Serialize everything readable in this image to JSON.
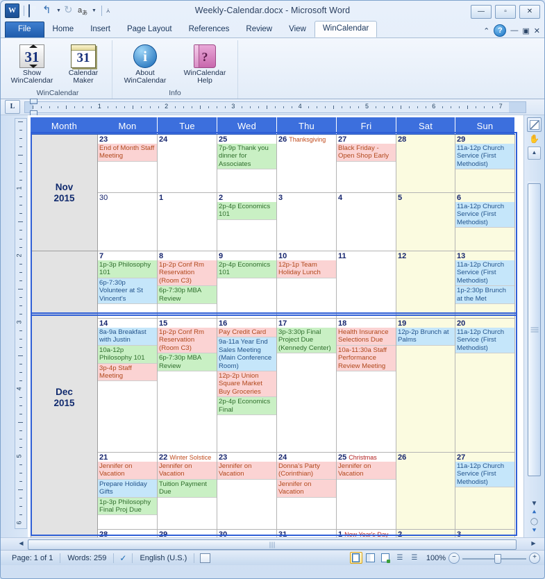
{
  "window": {
    "title": "Weekly-Calendar.docx  -  Microsoft Word",
    "app_icon": "W",
    "quick_access": [
      "save-icon",
      "undo-icon",
      "redo-icon",
      "language-icon",
      "customize-qat-icon"
    ],
    "minimize": "—",
    "restore": "▫",
    "close": "✕"
  },
  "tabs": [
    {
      "label": "File",
      "type": "file"
    },
    {
      "label": "Home",
      "type": "normal"
    },
    {
      "label": "Insert",
      "type": "normal"
    },
    {
      "label": "Page Layout",
      "type": "normal"
    },
    {
      "label": "References",
      "type": "normal"
    },
    {
      "label": "Review",
      "type": "normal"
    },
    {
      "label": "View",
      "type": "normal"
    },
    {
      "label": "WinCalendar",
      "type": "active"
    }
  ],
  "tab_right": {
    "help": "?",
    "minimize_ribbon": "—",
    "restore_win": "▣",
    "close_win": "✕"
  },
  "ribbon": {
    "groups": [
      {
        "label": "WinCalendar",
        "buttons": [
          {
            "label1": "Show",
            "label2": "WinCalendar",
            "icon": "calendar-31-spinner-icon",
            "glyph": "31"
          },
          {
            "label1": "Calendar",
            "label2": "Maker",
            "icon": "calendar-31-icon",
            "glyph": "31"
          }
        ]
      },
      {
        "label": "Info",
        "buttons": [
          {
            "label1": "About",
            "label2": "WinCalendar",
            "icon": "info-circle-icon",
            "glyph": "i"
          },
          {
            "label1": "WinCalendar",
            "label2": "Help",
            "icon": "help-book-icon",
            "glyph": "?"
          }
        ]
      }
    ]
  },
  "ruler": {
    "tab_stop": "L",
    "h_numbers": [
      "1",
      "2",
      "3",
      "4",
      "5",
      "6",
      "7"
    ],
    "v_numbers": [
      "1",
      "2",
      "3",
      "4",
      "5",
      "6"
    ]
  },
  "calendar": {
    "headers": [
      "Month",
      "Mon",
      "Tue",
      "Wed",
      "Thu",
      "Fri",
      "Sat",
      "Sun"
    ],
    "months": [
      {
        "name": "Nov",
        "year": "2015"
      },
      {
        "name": "Dec",
        "year": "2015"
      }
    ],
    "weeks": [
      {
        "month_label": "Nov\n2015",
        "days": [
          {
            "num": "23",
            "holiday": "",
            "weekend": false,
            "events": [
              {
                "text": "End of Month Staff Meeting",
                "color": "pink"
              }
            ]
          },
          {
            "num": "24",
            "holiday": "",
            "weekend": false,
            "events": []
          },
          {
            "num": "25",
            "holiday": "",
            "weekend": false,
            "events": [
              {
                "text": "7p-9p Thank you dinner for Associates",
                "color": "green"
              }
            ]
          },
          {
            "num": "26",
            "holiday": "Thanksgiving",
            "weekend": false,
            "events": []
          },
          {
            "num": "27",
            "holiday": "",
            "weekend": false,
            "events": [
              {
                "text": "Black Friday - Open Shop Early",
                "color": "pink"
              }
            ]
          },
          {
            "num": "28",
            "holiday": "",
            "weekend": true,
            "events": []
          },
          {
            "num": "29",
            "holiday": "",
            "weekend": true,
            "events": [
              {
                "text": "11a-12p Church Service (First Methodist)",
                "color": "blue"
              }
            ]
          }
        ]
      },
      {
        "month_label": "",
        "selected": true,
        "days": [
          {
            "num": "30",
            "dim": true,
            "holiday": "",
            "weekend": false,
            "events": []
          },
          {
            "num": "1",
            "holiday": "",
            "weekend": false,
            "events": []
          },
          {
            "num": "2",
            "holiday": "",
            "weekend": false,
            "events": [
              {
                "text": "2p-4p Economics 101",
                "color": "green"
              }
            ]
          },
          {
            "num": "3",
            "holiday": "",
            "weekend": false,
            "events": []
          },
          {
            "num": "4",
            "holiday": "",
            "weekend": false,
            "events": []
          },
          {
            "num": "5",
            "holiday": "",
            "weekend": true,
            "events": []
          },
          {
            "num": "6",
            "holiday": "",
            "weekend": true,
            "events": [
              {
                "text": "11a-12p Church Service (First Methodist)",
                "color": "blue"
              }
            ]
          }
        ]
      },
      {
        "month_label": "Dec\n2015",
        "days": [
          {
            "num": "7",
            "holiday": "",
            "weekend": false,
            "events": [
              {
                "text": "1p-3p Philosophy 101",
                "color": "green"
              },
              {
                "text": "6p-7:30p Volunteer at St Vincent's",
                "color": "blue"
              }
            ]
          },
          {
            "num": "8",
            "holiday": "",
            "weekend": false,
            "events": [
              {
                "text": "1p-2p Conf Rm Reservation (Room C3)",
                "color": "pink"
              },
              {
                "text": "6p-7:30p MBA Review",
                "color": "green"
              }
            ]
          },
          {
            "num": "9",
            "holiday": "",
            "weekend": false,
            "events": [
              {
                "text": "2p-4p Economics 101",
                "color": "green"
              }
            ]
          },
          {
            "num": "10",
            "holiday": "",
            "weekend": false,
            "events": [
              {
                "text": "12p-1p Team Holiday Lunch",
                "color": "pink"
              }
            ]
          },
          {
            "num": "11",
            "holiday": "",
            "weekend": false,
            "events": []
          },
          {
            "num": "12",
            "holiday": "",
            "weekend": true,
            "events": []
          },
          {
            "num": "13",
            "holiday": "",
            "weekend": true,
            "events": [
              {
                "text": "11a-12p Church Service (First Methodist)",
                "color": "blue"
              },
              {
                "text": "1p-2:30p Brunch at the Met",
                "color": "blue"
              }
            ]
          }
        ]
      },
      {
        "month_label": "",
        "days": [
          {
            "num": "14",
            "holiday": "",
            "weekend": false,
            "events": [
              {
                "text": "8a-9a Breakfast with Justin",
                "color": "blue"
              },
              {
                "text": "10a-12p Philosophy 101",
                "color": "green"
              },
              {
                "text": "3p-4p Staff Meeting",
                "color": "pink"
              }
            ]
          },
          {
            "num": "15",
            "holiday": "",
            "weekend": false,
            "events": [
              {
                "text": "1p-2p Conf Rm Reservation (Room C3)",
                "color": "pink"
              },
              {
                "text": "6p-7:30p MBA Review",
                "color": "green"
              }
            ]
          },
          {
            "num": "16",
            "holiday": "",
            "weekend": false,
            "events": [
              {
                "text": "Pay Credit Card",
                "color": "pink"
              },
              {
                "text": "9a-11a Year End Sales Meeting (Main Conference Room)",
                "color": "blue"
              },
              {
                "text": "12p-2p Union Square Market Buy Groceries",
                "color": "pink"
              },
              {
                "text": "2p-4p Economics Final",
                "color": "green"
              }
            ]
          },
          {
            "num": "17",
            "holiday": "",
            "weekend": false,
            "events": [
              {
                "text": "3p-3:30p Final Project Due (Kennedy Center)",
                "color": "green"
              }
            ]
          },
          {
            "num": "18",
            "holiday": "",
            "weekend": false,
            "events": [
              {
                "text": "Health Insurance Selections Due",
                "color": "pink"
              },
              {
                "text": "10a-11:30a Staff Performance Review Meeting",
                "color": "pink"
              }
            ]
          },
          {
            "num": "19",
            "holiday": "",
            "weekend": true,
            "events": [
              {
                "text": "12p-2p Brunch at Palms",
                "color": "blue"
              }
            ]
          },
          {
            "num": "20",
            "holiday": "",
            "weekend": true,
            "events": [
              {
                "text": "11a-12p Church Service (First Methodist)",
                "color": "blue"
              }
            ]
          }
        ]
      },
      {
        "month_label": "",
        "days": [
          {
            "num": "21",
            "holiday": "",
            "weekend": false,
            "events": [
              {
                "text": "Jennifer on Vacation",
                "color": "pink"
              },
              {
                "text": "Prepare Holiday Gifts",
                "color": "blue"
              },
              {
                "text": "1p-3p Philosophy Final Proj Due",
                "color": "green"
              }
            ]
          },
          {
            "num": "22",
            "holiday": "Winter Solstice",
            "weekend": false,
            "events": [
              {
                "text": "Jennifer on Vacation",
                "color": "pink"
              },
              {
                "text": "Tuition Payment Due",
                "color": "green"
              }
            ]
          },
          {
            "num": "23",
            "holiday": "",
            "weekend": false,
            "events": [
              {
                "text": "Jennifer on Vacation",
                "color": "pink"
              }
            ]
          },
          {
            "num": "24",
            "holiday": "",
            "weekend": false,
            "events": [
              {
                "text": "Donna's Party (Corinthian)",
                "color": "pink"
              },
              {
                "text": "Jennifer on Vacation",
                "color": "pink"
              }
            ]
          },
          {
            "num": "25",
            "holiday": "Christmas",
            "holiday_red": true,
            "weekend": false,
            "events": [
              {
                "text": "Jennifer on Vacation",
                "color": "pink"
              }
            ]
          },
          {
            "num": "26",
            "holiday": "",
            "weekend": true,
            "events": []
          },
          {
            "num": "27",
            "holiday": "",
            "weekend": true,
            "events": [
              {
                "text": "11a-12p Church Service (First Methodist)",
                "color": "blue"
              }
            ]
          }
        ]
      },
      {
        "month_label": "",
        "partial": true,
        "days": [
          {
            "num": "28",
            "holiday": "",
            "weekend": false,
            "events": []
          },
          {
            "num": "29",
            "holiday": "",
            "weekend": false,
            "events": []
          },
          {
            "num": "30",
            "holiday": "",
            "weekend": false,
            "events": []
          },
          {
            "num": "31",
            "holiday": "",
            "weekend": false,
            "events": []
          },
          {
            "num": "1",
            "holiday": "New Year's Day",
            "holiday_red": true,
            "weekend": false,
            "events": []
          },
          {
            "num": "2",
            "holiday": "",
            "weekend": true,
            "events": []
          },
          {
            "num": "3",
            "holiday": "",
            "weekend": true,
            "events": []
          }
        ]
      }
    ]
  },
  "status": {
    "page": "Page: 1 of 1",
    "words": "Words: 259",
    "proofing_icon": "spellcheck-icon",
    "language": "English (U.S.)",
    "macro_icon": "macro-record-icon",
    "views": [
      "print-layout-icon",
      "full-screen-reading-icon",
      "web-layout-icon",
      "outline-icon",
      "draft-icon"
    ],
    "zoom": "100%",
    "zoom_out": "−",
    "zoom_in": "+"
  },
  "colors": {
    "header_blue": "#3c6fdd",
    "event_pink": "#fbd3d3",
    "event_green": "#c9f0c4",
    "event_blue": "#c5e6fa",
    "weekend_bg": "#fbfbe0",
    "month_bg": "#e3e3e3",
    "selection": "#2f5fd6"
  }
}
